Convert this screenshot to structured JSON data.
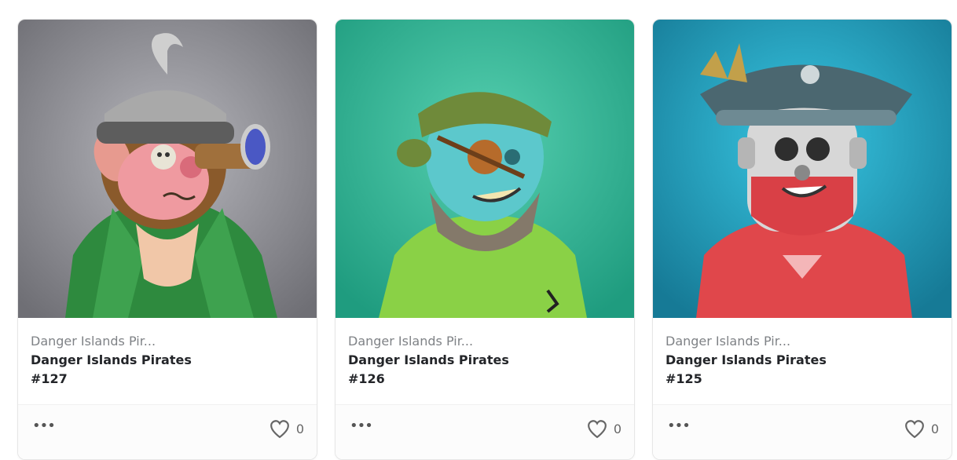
{
  "cards": [
    {
      "collection": "Danger Islands Pir...",
      "title": "Danger Islands Pirates",
      "token": "#127",
      "likes": "0",
      "art_theme": "monkey pirate with spyglass on grey background",
      "background_color": "#8f8f95"
    },
    {
      "collection": "Danger Islands Pir...",
      "title": "Danger Islands Pirates",
      "token": "#126",
      "likes": "0",
      "art_theme": "zombie pirate with eyepatch on teal background",
      "background_color": "#3bb79a"
    },
    {
      "collection": "Danger Islands Pir...",
      "title": "Danger Islands Pirates",
      "token": "#125",
      "likes": "0",
      "art_theme": "robot pirate captain on blue background",
      "background_color": "#1f93b3"
    }
  ],
  "icons": {
    "more": "more-horizontal-icon",
    "like": "heart-icon"
  }
}
